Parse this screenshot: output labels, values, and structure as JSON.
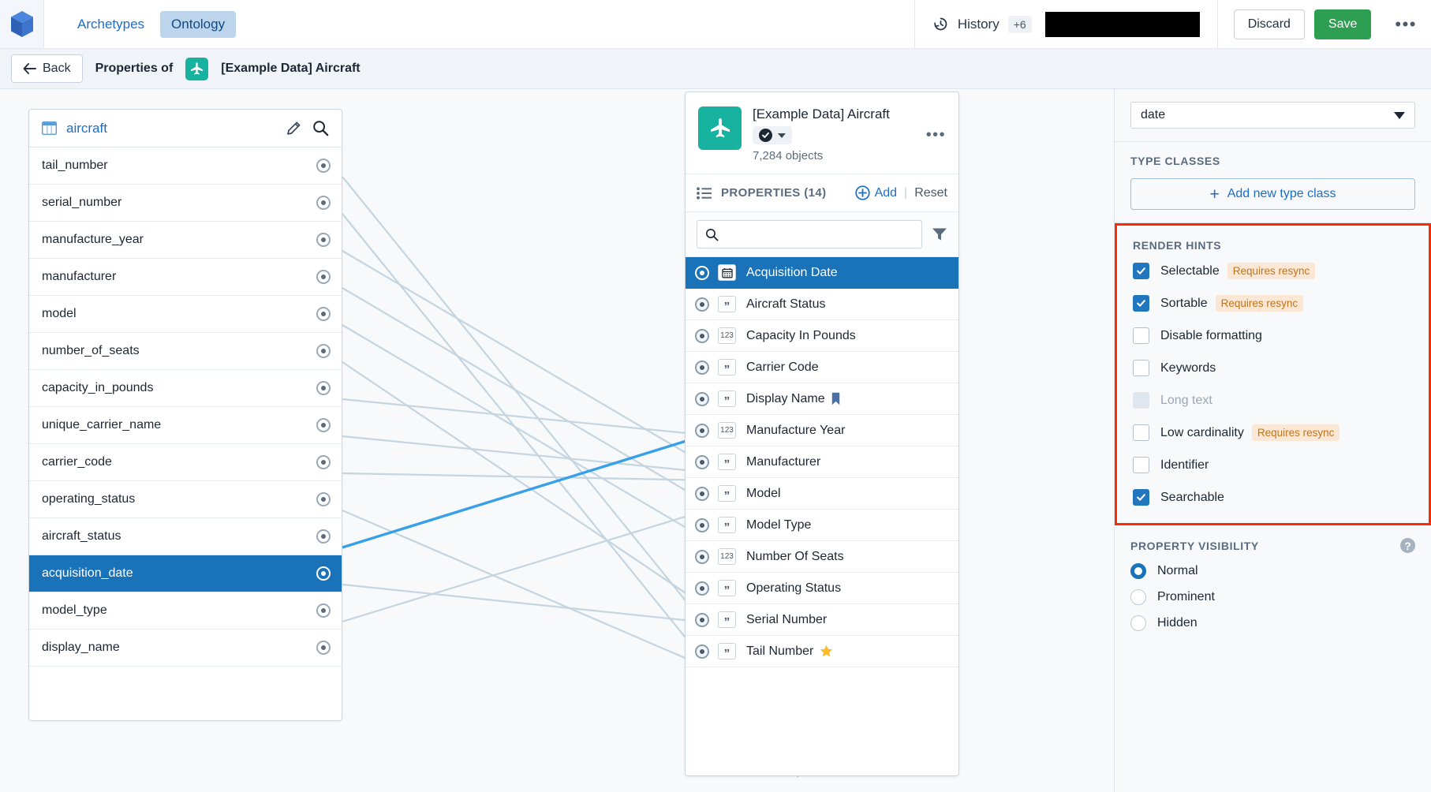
{
  "topnav": {
    "logo": "cube-logo",
    "tabs": [
      {
        "label": "Archetypes",
        "active": false
      },
      {
        "label": "Ontology",
        "active": true
      }
    ],
    "history_label": "History",
    "history_badge": "+6",
    "discard_label": "Discard",
    "save_label": "Save",
    "overflow": "•••"
  },
  "subheader": {
    "back_label": "Back",
    "properties_of_label": "Properties of",
    "object_title": "[Example Data] Aircraft"
  },
  "datasource_card": {
    "name": "aircraft",
    "columns": [
      {
        "name": "tail_number",
        "selected": false
      },
      {
        "name": "serial_number",
        "selected": false
      },
      {
        "name": "manufacture_year",
        "selected": false
      },
      {
        "name": "manufacturer",
        "selected": false
      },
      {
        "name": "model",
        "selected": false
      },
      {
        "name": "number_of_seats",
        "selected": false
      },
      {
        "name": "capacity_in_pounds",
        "selected": false
      },
      {
        "name": "unique_carrier_name",
        "selected": false
      },
      {
        "name": "carrier_code",
        "selected": false
      },
      {
        "name": "operating_status",
        "selected": false
      },
      {
        "name": "aircraft_status",
        "selected": false
      },
      {
        "name": "acquisition_date",
        "selected": true
      },
      {
        "name": "model_type",
        "selected": false
      },
      {
        "name": "display_name",
        "selected": false
      }
    ]
  },
  "object_card": {
    "title": "[Example Data] Aircraft",
    "object_count": "7,284 objects",
    "properties_header": "PROPERTIES (14)",
    "add_label": "Add",
    "separator": "|",
    "reset_label": "Reset",
    "search_placeholder": "",
    "search_value": "",
    "properties": [
      {
        "label": "Acquisition Date",
        "type": "date",
        "selected": true,
        "trailing": ""
      },
      {
        "label": "Aircraft Status",
        "type": "string",
        "selected": false,
        "trailing": ""
      },
      {
        "label": "Capacity In Pounds",
        "type": "123",
        "selected": false,
        "trailing": ""
      },
      {
        "label": "Carrier Code",
        "type": "string",
        "selected": false,
        "trailing": ""
      },
      {
        "label": "Display Name",
        "type": "string",
        "selected": false,
        "trailing": "bookmark"
      },
      {
        "label": "Manufacture Year",
        "type": "123",
        "selected": false,
        "trailing": ""
      },
      {
        "label": "Manufacturer",
        "type": "string",
        "selected": false,
        "trailing": ""
      },
      {
        "label": "Model",
        "type": "string",
        "selected": false,
        "trailing": ""
      },
      {
        "label": "Model Type",
        "type": "string",
        "selected": false,
        "trailing": ""
      },
      {
        "label": "Number Of Seats",
        "type": "123",
        "selected": false,
        "trailing": ""
      },
      {
        "label": "Operating Status",
        "type": "string",
        "selected": false,
        "trailing": ""
      },
      {
        "label": "Serial Number",
        "type": "string",
        "selected": false,
        "trailing": ""
      },
      {
        "label": "Tail Number",
        "type": "string",
        "selected": false,
        "trailing": "star"
      }
    ]
  },
  "right_panel": {
    "type_value": "date",
    "type_classes_header": "TYPE CLASSES",
    "add_type_class_label": "Add new type class",
    "render_hints_header": "RENDER HINTS",
    "render_hints": [
      {
        "label": "Selectable",
        "checked": true,
        "disabled": false,
        "badge": "Requires resync"
      },
      {
        "label": "Sortable",
        "checked": true,
        "disabled": false,
        "badge": "Requires resync"
      },
      {
        "label": "Disable formatting",
        "checked": false,
        "disabled": false,
        "badge": ""
      },
      {
        "label": "Keywords",
        "checked": false,
        "disabled": false,
        "badge": ""
      },
      {
        "label": "Long text",
        "checked": false,
        "disabled": true,
        "badge": ""
      },
      {
        "label": "Low cardinality",
        "checked": false,
        "disabled": false,
        "badge": "Requires resync"
      },
      {
        "label": "Identifier",
        "checked": false,
        "disabled": false,
        "badge": ""
      },
      {
        "label": "Searchable",
        "checked": true,
        "disabled": false,
        "badge": ""
      }
    ],
    "property_visibility_header": "PROPERTY VISIBILITY",
    "help_glyph": "?",
    "visibility_options": [
      {
        "label": "Normal",
        "selected": true
      },
      {
        "label": "Prominent",
        "selected": false
      },
      {
        "label": "Hidden",
        "selected": false
      }
    ]
  },
  "colors": {
    "accent_blue": "#1a72b8",
    "link_blue": "#1c6ec4",
    "save_green": "#2e9e52",
    "teal_icon": "#18b2a0",
    "highlight_red": "#fc2a00",
    "resync_orange": "#c0741c",
    "edge_blue": "#38a0e8"
  }
}
